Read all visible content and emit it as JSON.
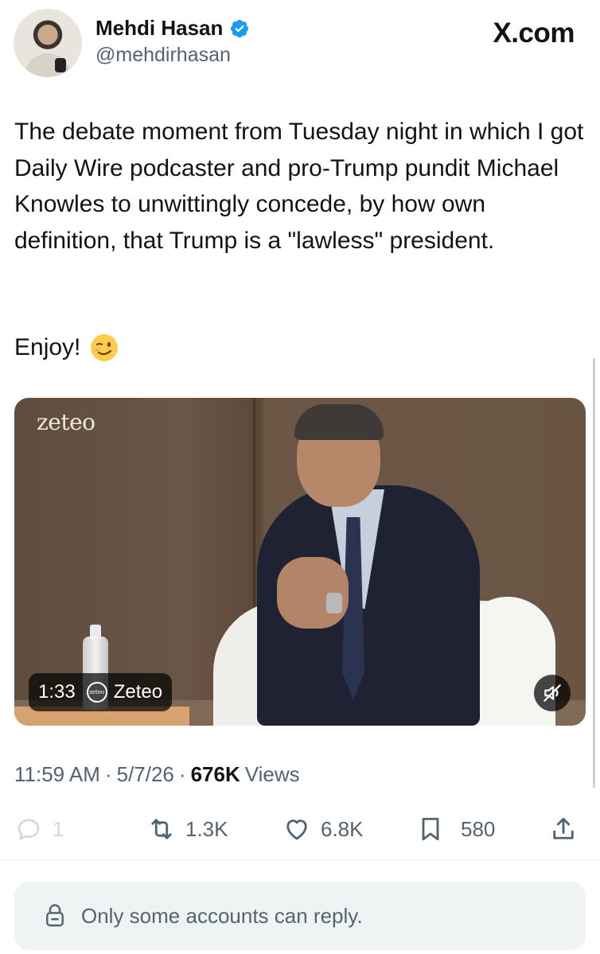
{
  "author": {
    "name": "Mehdi Hasan",
    "handle": "@mehdirhasan",
    "verified": true
  },
  "source_label": "X.com",
  "tweet": {
    "text": "The debate moment from Tuesday night in which I got Daily Wire podcaster and pro-Trump pundit Michael Knowles to unwittingly concede, by how own definition, that Trump is a \"lawless\" president.",
    "closing": "Enjoy!",
    "closing_emoji": "winking-face-icon"
  },
  "media": {
    "watermark": "zeteo",
    "duration": "1:33",
    "channel_logo_text": "zeteo",
    "channel_name": "Zeteo",
    "muted": true
  },
  "meta": {
    "time": "11:59 AM",
    "date": "5/7/26",
    "views_count": "676K",
    "views_label": "Views",
    "separator": "·"
  },
  "actions": {
    "replies": "1",
    "reposts": "1.3K",
    "likes": "6.8K",
    "bookmarks": "580"
  },
  "reply_restriction": "Only some accounts can reply.",
  "colors": {
    "text_primary": "#0f1419",
    "text_secondary": "#536471",
    "verified_blue": "#1d9bf0",
    "reply_box_bg": "#eff3f4"
  }
}
